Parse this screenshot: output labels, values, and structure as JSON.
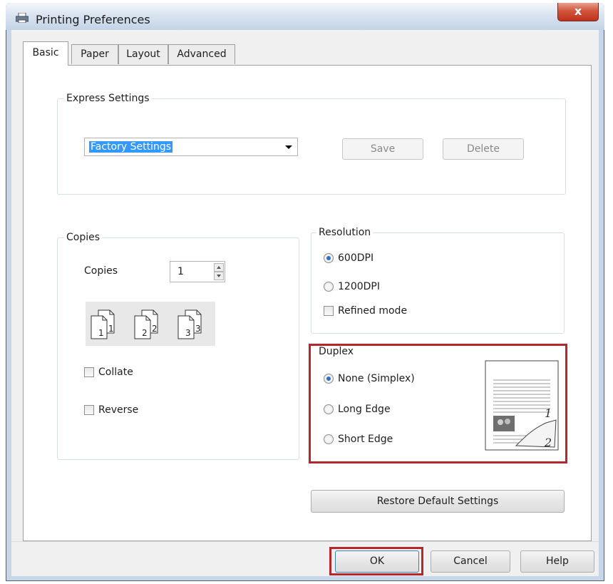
{
  "window": {
    "title": "Printing Preferences",
    "close_symbol": "x"
  },
  "tabs": [
    {
      "label": "Basic",
      "active": true
    },
    {
      "label": "Paper",
      "active": false
    },
    {
      "label": "Layout",
      "active": false
    },
    {
      "label": "Advanced",
      "active": false
    }
  ],
  "express_settings": {
    "label": "Express Settings",
    "selected": "Factory Settings",
    "save_label": "Save",
    "delete_label": "Delete"
  },
  "copies": {
    "group_label": "Copies",
    "field_label": "Copies",
    "value": "1",
    "collate_illustration_numbers": [
      "1",
      "1",
      "2",
      "2",
      "3",
      "3"
    ],
    "collate_label": "Collate",
    "collate_checked": false,
    "reverse_label": "Reverse",
    "reverse_checked": false
  },
  "resolution": {
    "group_label": "Resolution",
    "options": [
      {
        "label": "600DPI",
        "checked": true
      },
      {
        "label": "1200DPI",
        "checked": false
      }
    ],
    "refined_label": "Refined mode",
    "refined_checked": false
  },
  "duplex": {
    "group_label": "Duplex",
    "options": [
      {
        "label": "None (Simplex)",
        "checked": true
      },
      {
        "label": "Long Edge",
        "checked": false
      },
      {
        "label": "Short Edge",
        "checked": false
      }
    ],
    "preview_page_numbers": [
      "1",
      "2"
    ]
  },
  "restore_label": "Restore Default Settings",
  "footer": {
    "ok_label": "OK",
    "cancel_label": "Cancel",
    "help_label": "Help"
  },
  "colors": {
    "highlight": "#b3272d",
    "selection": "#3399ff",
    "radio_dot": "#2a6fc9"
  }
}
